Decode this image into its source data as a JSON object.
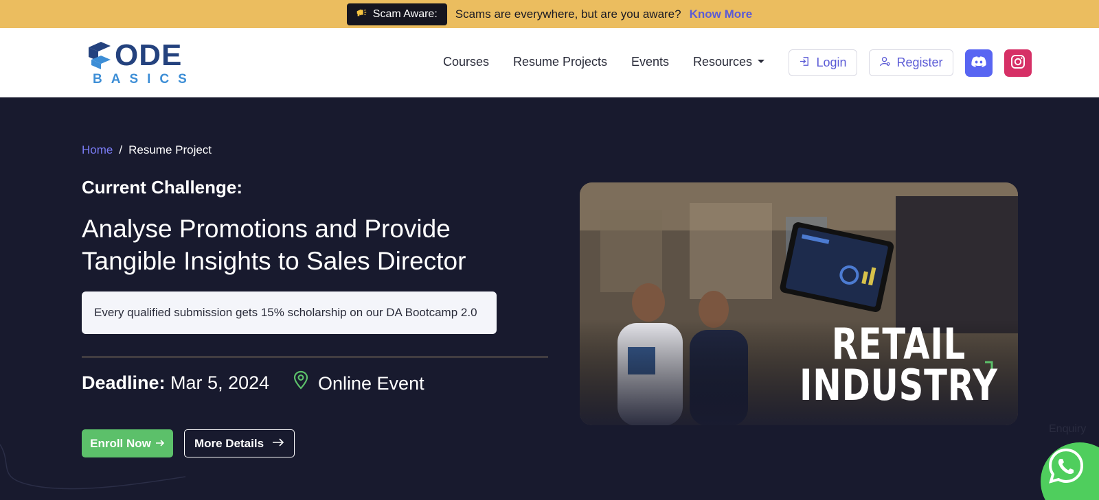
{
  "announcement": {
    "badge_label": "Scam Aware:",
    "badge_icon": "megaphone-icon",
    "message": "Scams are everywhere, but are you aware?",
    "link_label": "Know More"
  },
  "header": {
    "logo_letters": "ODE",
    "logo_subtitle": "BASICS",
    "nav": {
      "courses": "Courses",
      "resume_projects": "Resume Projects",
      "events": "Events",
      "resources": "Resources"
    },
    "login_label": "Login",
    "register_label": "Register",
    "social": [
      "discord-icon",
      "instagram-icon"
    ]
  },
  "hero": {
    "breadcrumb": {
      "home": "Home",
      "separator": "/",
      "current": "Resume Project"
    },
    "challenge_label": "Current Challenge:",
    "title": "Analyse Promotions and Provide Tangible Insights to Sales Director",
    "scholarship_note": "Every qualified submission gets 15% scholarship on our DA Bootcamp 2.0",
    "deadline_label": "Deadline:",
    "deadline_value": "Mar 5, 2024",
    "location": "Online Event",
    "enroll_label": "Enroll Now",
    "details_label": "More Details",
    "image_caption_line1": "RETAIL",
    "image_caption_line2": "INDUSTRY"
  },
  "widgets": {
    "enquiry_label": "Enquiry"
  },
  "colors": {
    "topbar": "#ebbd5f",
    "hero_bg": "#181a2e",
    "accent": "#5b5bd6",
    "enroll": "#5cc06a",
    "discord": "#5865f2",
    "instagram": "#d63066",
    "whatsapp": "#4fce5d"
  }
}
